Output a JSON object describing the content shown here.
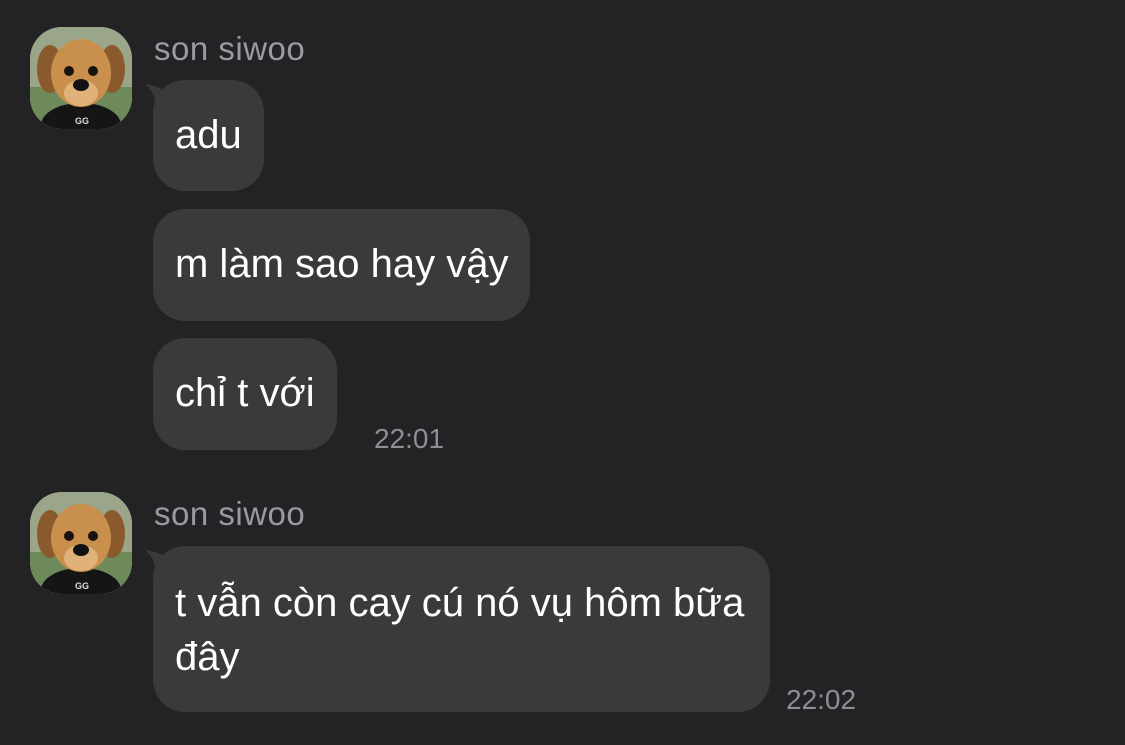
{
  "groups": [
    {
      "sender": "son siwoo",
      "messages": [
        {
          "text": "adu"
        },
        {
          "text": "m làm sao hay vậy"
        },
        {
          "text": "chỉ t với"
        }
      ],
      "time": "22:01"
    },
    {
      "sender": "son siwoo",
      "messages": [
        {
          "text": "t vẫn còn cay cú nó vụ hôm bữa đây"
        }
      ],
      "time": "22:02"
    }
  ],
  "colors": {
    "background": "#232326",
    "bubble": "#3a3a3d",
    "sender_text": "#9a9aa0",
    "time_text": "#8e8e93",
    "message_text": "#ffffff"
  },
  "icons": {
    "avatar": "puppy-avatar"
  }
}
